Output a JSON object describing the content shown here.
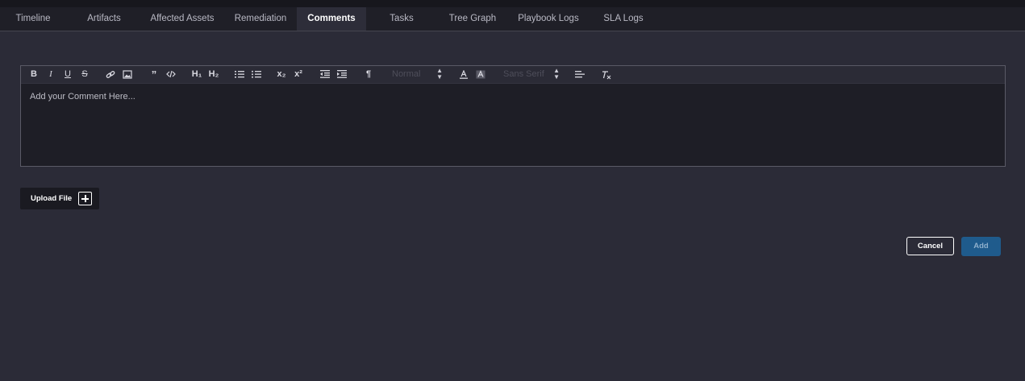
{
  "tabs": [
    {
      "label": "Timeline",
      "active": false
    },
    {
      "label": "Artifacts",
      "active": false
    },
    {
      "label": "Affected Assets",
      "active": false
    },
    {
      "label": "Remediation",
      "active": false
    },
    {
      "label": "Comments",
      "active": true
    },
    {
      "label": "Tasks",
      "active": false
    },
    {
      "label": "Tree Graph",
      "active": false
    },
    {
      "label": "Playbook Logs",
      "active": false
    },
    {
      "label": "SLA Logs",
      "active": false
    }
  ],
  "editor": {
    "placeholder": "Add your Comment Here...",
    "toolbar": {
      "bold": "B",
      "italic": "I",
      "underline": "U",
      "strike": "S",
      "h1": "H₁",
      "h2": "H₂",
      "sub": "x₂",
      "super": "x²",
      "direction": "¶",
      "size_value": "Normal",
      "font_value": "Sans Serif"
    }
  },
  "upload": {
    "label": "Upload File"
  },
  "actions": {
    "cancel": "Cancel",
    "add": "Add"
  },
  "colors": {
    "accent": "#1f5b8c",
    "background": "#2b2b37",
    "tab_active": "#2d2d39"
  }
}
